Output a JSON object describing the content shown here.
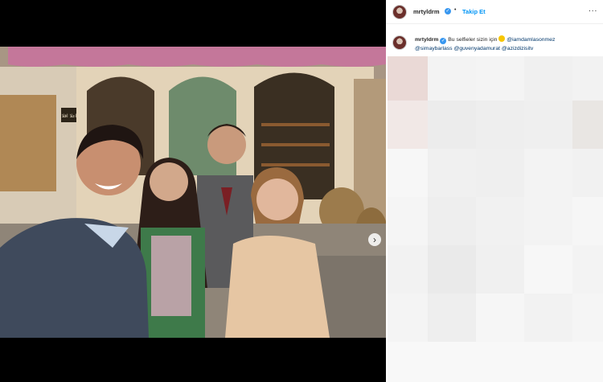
{
  "post": {
    "username": "mrtyldrm",
    "follow_label": "Takip Et",
    "separator": "•",
    "more_label": "...",
    "caption": {
      "username": "mrtyldrm",
      "text": "Bu selfieler sizin için",
      "mentions": [
        "@iamdamlasonmez",
        "@simaybarlass",
        "@guvenyadamurat",
        "@azizdizisitv"
      ]
    }
  },
  "media": {
    "next_icon": "chevron-right-icon",
    "tag_icon": "person-tag-icon",
    "sign_text": "اعلا اقلا"
  },
  "colors": {
    "link": "#0095f6",
    "mention": "#00376b",
    "verified": "#3897f0"
  }
}
